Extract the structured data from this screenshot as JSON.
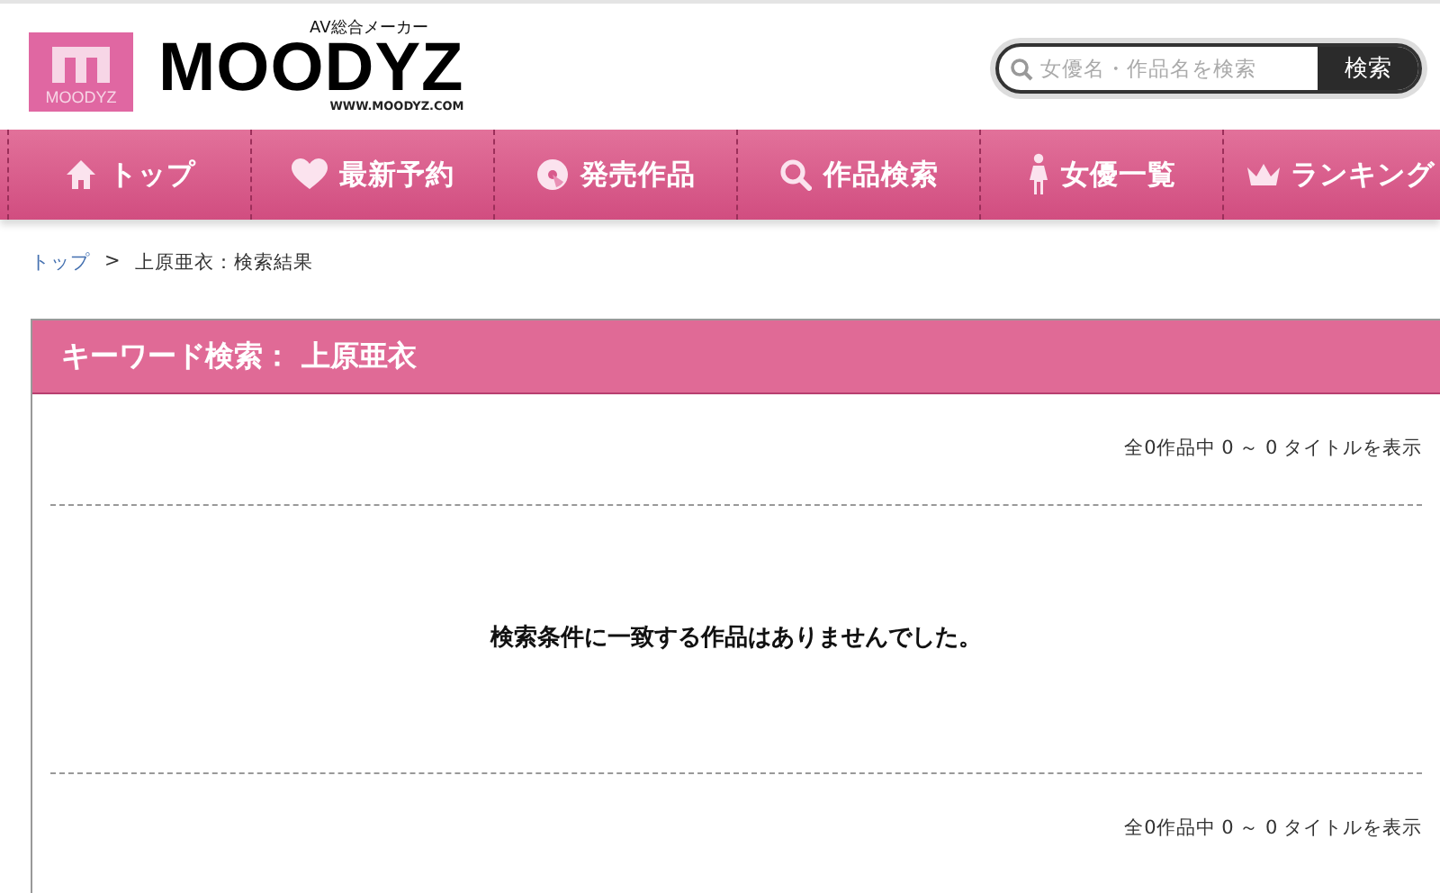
{
  "logo": {
    "badge_text": "MOODYZ",
    "wordmark": "MOODYZ",
    "tagline": "AV総合メーカー",
    "url": "WWW.MOODYZ.COM"
  },
  "search": {
    "placeholder": "女優名・作品名を検索",
    "button": "検索"
  },
  "nav": [
    {
      "label": "トップ"
    },
    {
      "label": "最新予約"
    },
    {
      "label": "発売作品"
    },
    {
      "label": "作品検索"
    },
    {
      "label": "女優一覧"
    },
    {
      "label": "ランキング"
    }
  ],
  "breadcrumb": {
    "link": "トップ",
    "separator": ">",
    "current": "上原亜衣：検索結果"
  },
  "panel": {
    "title": "キーワード検索： 上原亜衣",
    "count_top": "全0作品中 0 ～ 0 タイトルを表示",
    "message": "検索条件に一致する作品はありませんでした。",
    "count_bottom": "全0作品中 0 ～ 0 タイトルを表示"
  }
}
